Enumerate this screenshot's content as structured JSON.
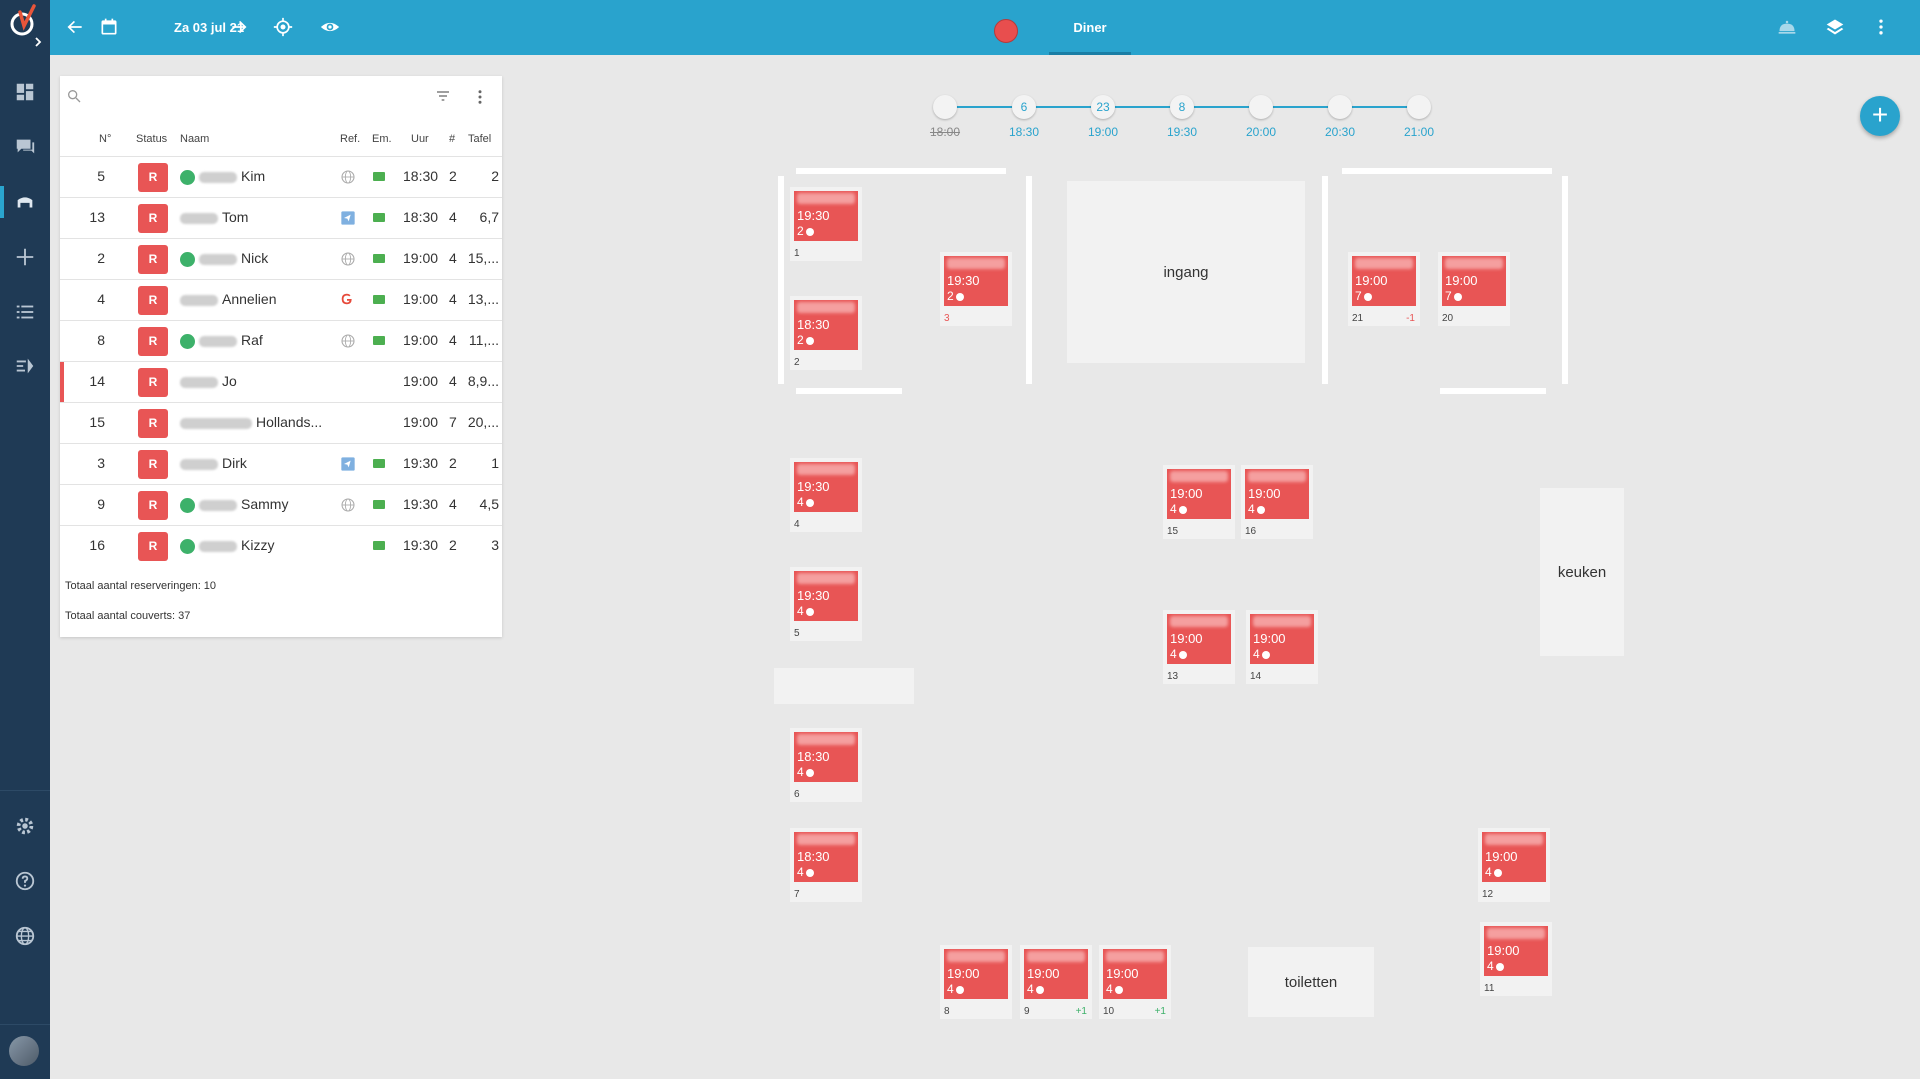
{
  "topbar": {
    "date": "Za 03 jul 21",
    "active_tab": "Diner"
  },
  "colors": {
    "accent": "#29a3cd",
    "rail": "#1f3a55",
    "reservation": "#e85555",
    "vip": "#3db16a"
  },
  "panel": {
    "headers": {
      "no": "N°",
      "status": "Status",
      "name": "Naam",
      "ref": "Ref.",
      "em": "Em.",
      "time": "Uur",
      "count": "#",
      "table": "Tafel"
    },
    "rows": [
      {
        "no": "5",
        "status": "R",
        "name": "Kim",
        "vip": true,
        "ref": "globe",
        "email": true,
        "time": "18:30",
        "count": "2",
        "table": "2"
      },
      {
        "no": "13",
        "status": "R",
        "name": "Tom",
        "vip": false,
        "ref": "arrow",
        "email": true,
        "time": "18:30",
        "count": "4",
        "table": "6,7"
      },
      {
        "no": "2",
        "status": "R",
        "name": "Nick",
        "vip": true,
        "ref": "globe",
        "email": true,
        "time": "19:00",
        "count": "4",
        "table": "15,..."
      },
      {
        "no": "4",
        "status": "R",
        "name": "Annelien",
        "vip": false,
        "ref": "google",
        "email": true,
        "time": "19:00",
        "count": "4",
        "table": "13,..."
      },
      {
        "no": "8",
        "status": "R",
        "name": "Raf",
        "vip": true,
        "ref": "globe",
        "email": true,
        "time": "19:00",
        "count": "4",
        "table": "11,..."
      },
      {
        "no": "14",
        "status": "R",
        "name": "Jo",
        "vip": false,
        "ref": "",
        "email": false,
        "time": "19:00",
        "count": "4",
        "table": "8,9..."
      },
      {
        "no": "15",
        "status": "R",
        "name": "Hollands...",
        "vip": false,
        "ref": "",
        "email": false,
        "time": "19:00",
        "count": "7",
        "table": "20,..."
      },
      {
        "no": "3",
        "status": "R",
        "name": "Dirk",
        "vip": false,
        "ref": "arrow",
        "email": true,
        "time": "19:30",
        "count": "2",
        "table": "1"
      },
      {
        "no": "9",
        "status": "R",
        "name": "Sammy",
        "vip": true,
        "ref": "globe",
        "email": true,
        "time": "19:30",
        "count": "4",
        "table": "4,5"
      },
      {
        "no": "16",
        "status": "R",
        "name": "Kizzy",
        "vip": true,
        "ref": "",
        "email": true,
        "time": "19:30",
        "count": "2",
        "table": "3"
      }
    ],
    "total_reservations": "Totaal aantal reserveringen: 10",
    "total_covers": "Totaal aantal couverts: 37"
  },
  "timeline": [
    {
      "time": "18:00",
      "count": "",
      "struck": true
    },
    {
      "time": "18:30",
      "count": "6",
      "struck": false
    },
    {
      "time": "19:00",
      "count": "23",
      "struck": false
    },
    {
      "time": "19:30",
      "count": "8",
      "struck": false
    },
    {
      "time": "20:00",
      "count": "",
      "struck": false
    },
    {
      "time": "20:30",
      "count": "",
      "struck": false
    },
    {
      "time": "21:00",
      "count": "",
      "struck": false
    }
  ],
  "zones": {
    "entrance": "ingang",
    "kitchen": "keuken",
    "toilets": "toiletten"
  },
  "tables": [
    {
      "no": "1",
      "time": "19:30",
      "covers": "2",
      "extra": ""
    },
    {
      "no": "2",
      "time": "18:30",
      "covers": "2",
      "extra": ""
    },
    {
      "no": "3",
      "time": "19:30",
      "covers": "2",
      "extra": ""
    },
    {
      "no": "21",
      "time": "19:00",
      "covers": "7",
      "extra": "-1"
    },
    {
      "no": "20",
      "time": "19:00",
      "covers": "7",
      "extra": ""
    },
    {
      "no": "4",
      "time": "19:30",
      "covers": "4",
      "extra": ""
    },
    {
      "no": "5",
      "time": "19:30",
      "covers": "4",
      "extra": ""
    },
    {
      "no": "15",
      "time": "19:00",
      "covers": "4",
      "extra": ""
    },
    {
      "no": "16",
      "time": "19:00",
      "covers": "4",
      "extra": ""
    },
    {
      "no": "13",
      "time": "19:00",
      "covers": "4",
      "extra": ""
    },
    {
      "no": "14",
      "time": "19:00",
      "covers": "4",
      "extra": ""
    },
    {
      "no": "6",
      "time": "18:30",
      "covers": "4",
      "extra": ""
    },
    {
      "no": "7",
      "time": "18:30",
      "covers": "4",
      "extra": ""
    },
    {
      "no": "12",
      "time": "19:00",
      "covers": "4",
      "extra": ""
    },
    {
      "no": "11",
      "time": "19:00",
      "covers": "4",
      "extra": ""
    },
    {
      "no": "8",
      "time": "19:00",
      "covers": "4",
      "extra": ""
    },
    {
      "no": "9",
      "time": "19:00",
      "covers": "4",
      "extra": "+1"
    },
    {
      "no": "10",
      "time": "19:00",
      "covers": "4",
      "extra": "+1"
    }
  ]
}
